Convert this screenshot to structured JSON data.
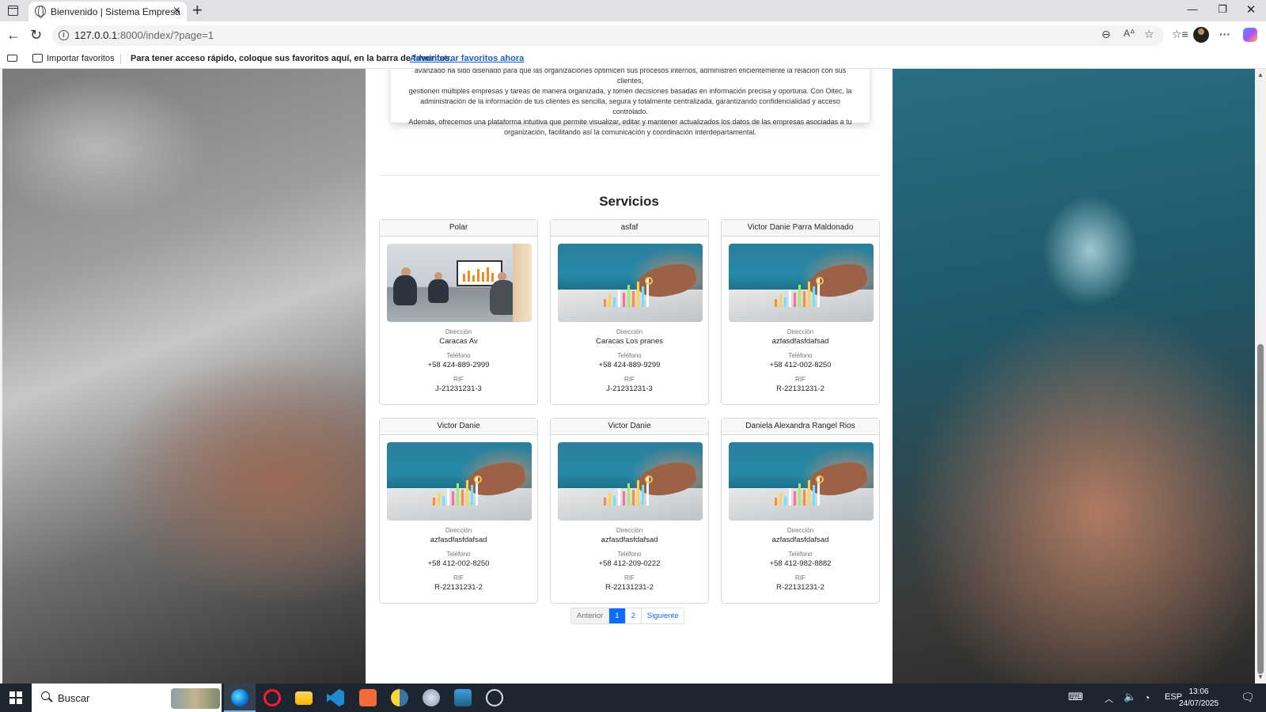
{
  "browser": {
    "tab_title": "Bienvenido | Sistema Empresa",
    "url_host": "127.0.0.1",
    "url_rest": ":8000/index/?page=1",
    "favorites": {
      "import_label": "Importar favoritos",
      "message": "Para tener acceso rápido, coloque sus favoritos aquí, en la barra de favoritos.",
      "manage_link": "Administrar favoritos ahora"
    }
  },
  "about": {
    "lines": [
      "avanzado ha sido diseñado para que las organizaciones optimicen sus procesos internos, administren eficientemente la relación con sus clientes,",
      "gestionen múltiples empresas y tareas de manera organizada, y tomen decisiones basadas en información precisa y oportuna. Con Oitec, la",
      "administración de la información de tus clientes es sencilla, segura y totalmente centralizada, garantizando confidencialidad y acceso controlado.",
      "Además, ofrecemos una plataforma intuitiva que permite visualizar, editar y mantener actualizados los datos de las empresas asociadas a tu",
      "organización, facilitando así la comunicación y coordinación interdepartamental."
    ]
  },
  "services": {
    "title": "Servicios",
    "field_labels": {
      "address": "Dirección",
      "phone": "Teléfono",
      "rif": "RIF"
    },
    "cards": [
      {
        "name": "Polar",
        "image": "meeting-photo",
        "address": "Caracas Av",
        "phone": "+58 424-889-2999",
        "rif": "J-21231231-3"
      },
      {
        "name": "asfaf",
        "image": "finance-chart-photo",
        "address": "Caracas Los pranes",
        "phone": "+58 424-889-9299",
        "rif": "J-21231231-3"
      },
      {
        "name": "Victor Danie Parra Maldonado",
        "image": "finance-chart-photo",
        "address": "azfasdfasfdafsad",
        "phone": "+58 412-002-8250",
        "rif": "R-22131231-2"
      },
      {
        "name": "Victor Danie",
        "image": "finance-chart-photo",
        "address": "azfasdfasfdafsad",
        "phone": "+58 412-002-8250",
        "rif": "R-22131231-2"
      },
      {
        "name": "Victor Danie",
        "image": "finance-chart-photo",
        "address": "azfasdfasfdafsad",
        "phone": "+58 412-209-0222",
        "rif": "R-22131231-2"
      },
      {
        "name": "Daniela Alexandra Rangel Rios",
        "image": "finance-chart-photo",
        "address": "azfasdfasfdafsad",
        "phone": "+58 412-982-8882",
        "rif": "R-22131231-2"
      }
    ]
  },
  "pagination": {
    "previous": "Anterior",
    "pages": [
      "1",
      "2"
    ],
    "current": "1",
    "next": "Siguiente"
  },
  "taskbar": {
    "search_placeholder": "Buscar",
    "language": "ESP",
    "time": "13:06",
    "date": "24/07/2025"
  },
  "colors": {
    "primary": "#0d6efd",
    "taskbar": "#1c2530"
  }
}
